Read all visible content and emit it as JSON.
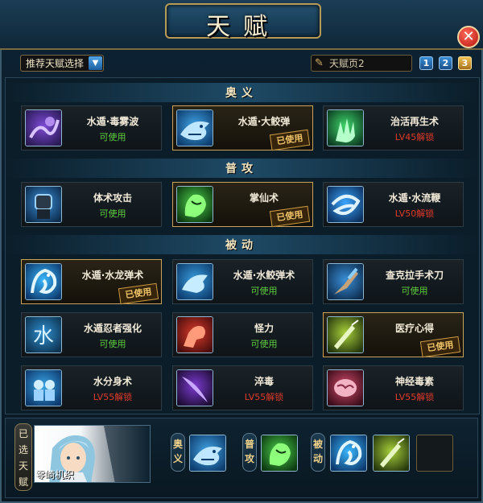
{
  "window": {
    "title": "天赋"
  },
  "toolbar": {
    "recommend_label": "推荐天赋选择",
    "page_field_value": "天赋页2",
    "page_buttons": [
      "1",
      "2",
      "3"
    ],
    "active_page": "3"
  },
  "sections": [
    {
      "title": "奥义",
      "cards": [
        {
          "name": "水遁·毒雾波",
          "status": "可使用",
          "state": "ok",
          "used": false,
          "icon": "poison-mist-icon"
        },
        {
          "name": "水遁·大鲛弹",
          "status": "",
          "state": "ok",
          "used": true,
          "icon": "shark-icon"
        },
        {
          "name": "治活再生术",
          "status": "LV45解锁",
          "state": "locked",
          "used": false,
          "icon": "healing-hand-icon"
        }
      ]
    },
    {
      "title": "普攻",
      "cards": [
        {
          "name": "体术攻击",
          "status": "可使用",
          "state": "ok",
          "used": false,
          "icon": "fist-icon"
        },
        {
          "name": "掌仙术",
          "status": "",
          "state": "ok",
          "used": true,
          "icon": "green-palm-icon"
        },
        {
          "name": "水遁·水流鞭",
          "status": "LV50解锁",
          "state": "locked",
          "used": false,
          "icon": "water-whip-icon"
        }
      ]
    },
    {
      "title": "被动",
      "cards": [
        {
          "name": "水遁·水龙弹术",
          "status": "",
          "state": "ok",
          "used": true,
          "icon": "water-dragon-icon"
        },
        {
          "name": "水遁·水鲛弹术",
          "status": "可使用",
          "state": "ok",
          "used": false,
          "icon": "water-shark-icon"
        },
        {
          "name": "查克拉手术刀",
          "status": "可使用",
          "state": "ok",
          "used": false,
          "icon": "chakra-scalpel-icon"
        },
        {
          "name": "水遁忍者强化",
          "status": "可使用",
          "state": "ok",
          "used": false,
          "icon": "water-kanji-icon"
        },
        {
          "name": "怪力",
          "status": "可使用",
          "state": "ok",
          "used": false,
          "icon": "strength-arm-icon"
        },
        {
          "name": "医疗心得",
          "status": "",
          "state": "ok",
          "used": true,
          "icon": "medical-needle-icon"
        },
        {
          "name": "水分身术",
          "status": "LV55解锁",
          "state": "locked",
          "used": false,
          "icon": "water-clone-icon"
        },
        {
          "name": "淬毒",
          "status": "LV55解锁",
          "state": "locked",
          "used": false,
          "icon": "poison-blade-icon"
        },
        {
          "name": "神经毒素",
          "status": "LV55解锁",
          "state": "locked",
          "used": false,
          "icon": "brain-toxin-icon"
        }
      ]
    }
  ],
  "used_label": "已使用",
  "selected": {
    "side_label": [
      "已",
      "选",
      "天",
      "赋"
    ],
    "character_name": "零崎机织",
    "slots": [
      {
        "label": [
          "奥",
          "义"
        ],
        "icon": "shark-icon"
      },
      {
        "label": [
          "普",
          "攻"
        ],
        "icon": "green-palm-icon"
      },
      {
        "label": [
          "被",
          "动"
        ],
        "icon": "water-dragon-icon"
      }
    ],
    "extra_passive_icon": "medical-needle-icon"
  },
  "colors": {
    "available": "#5fcf3f",
    "locked": "#e03a2a",
    "gold_border": "#c9a356",
    "accent_blue": "#3a8fd8"
  }
}
